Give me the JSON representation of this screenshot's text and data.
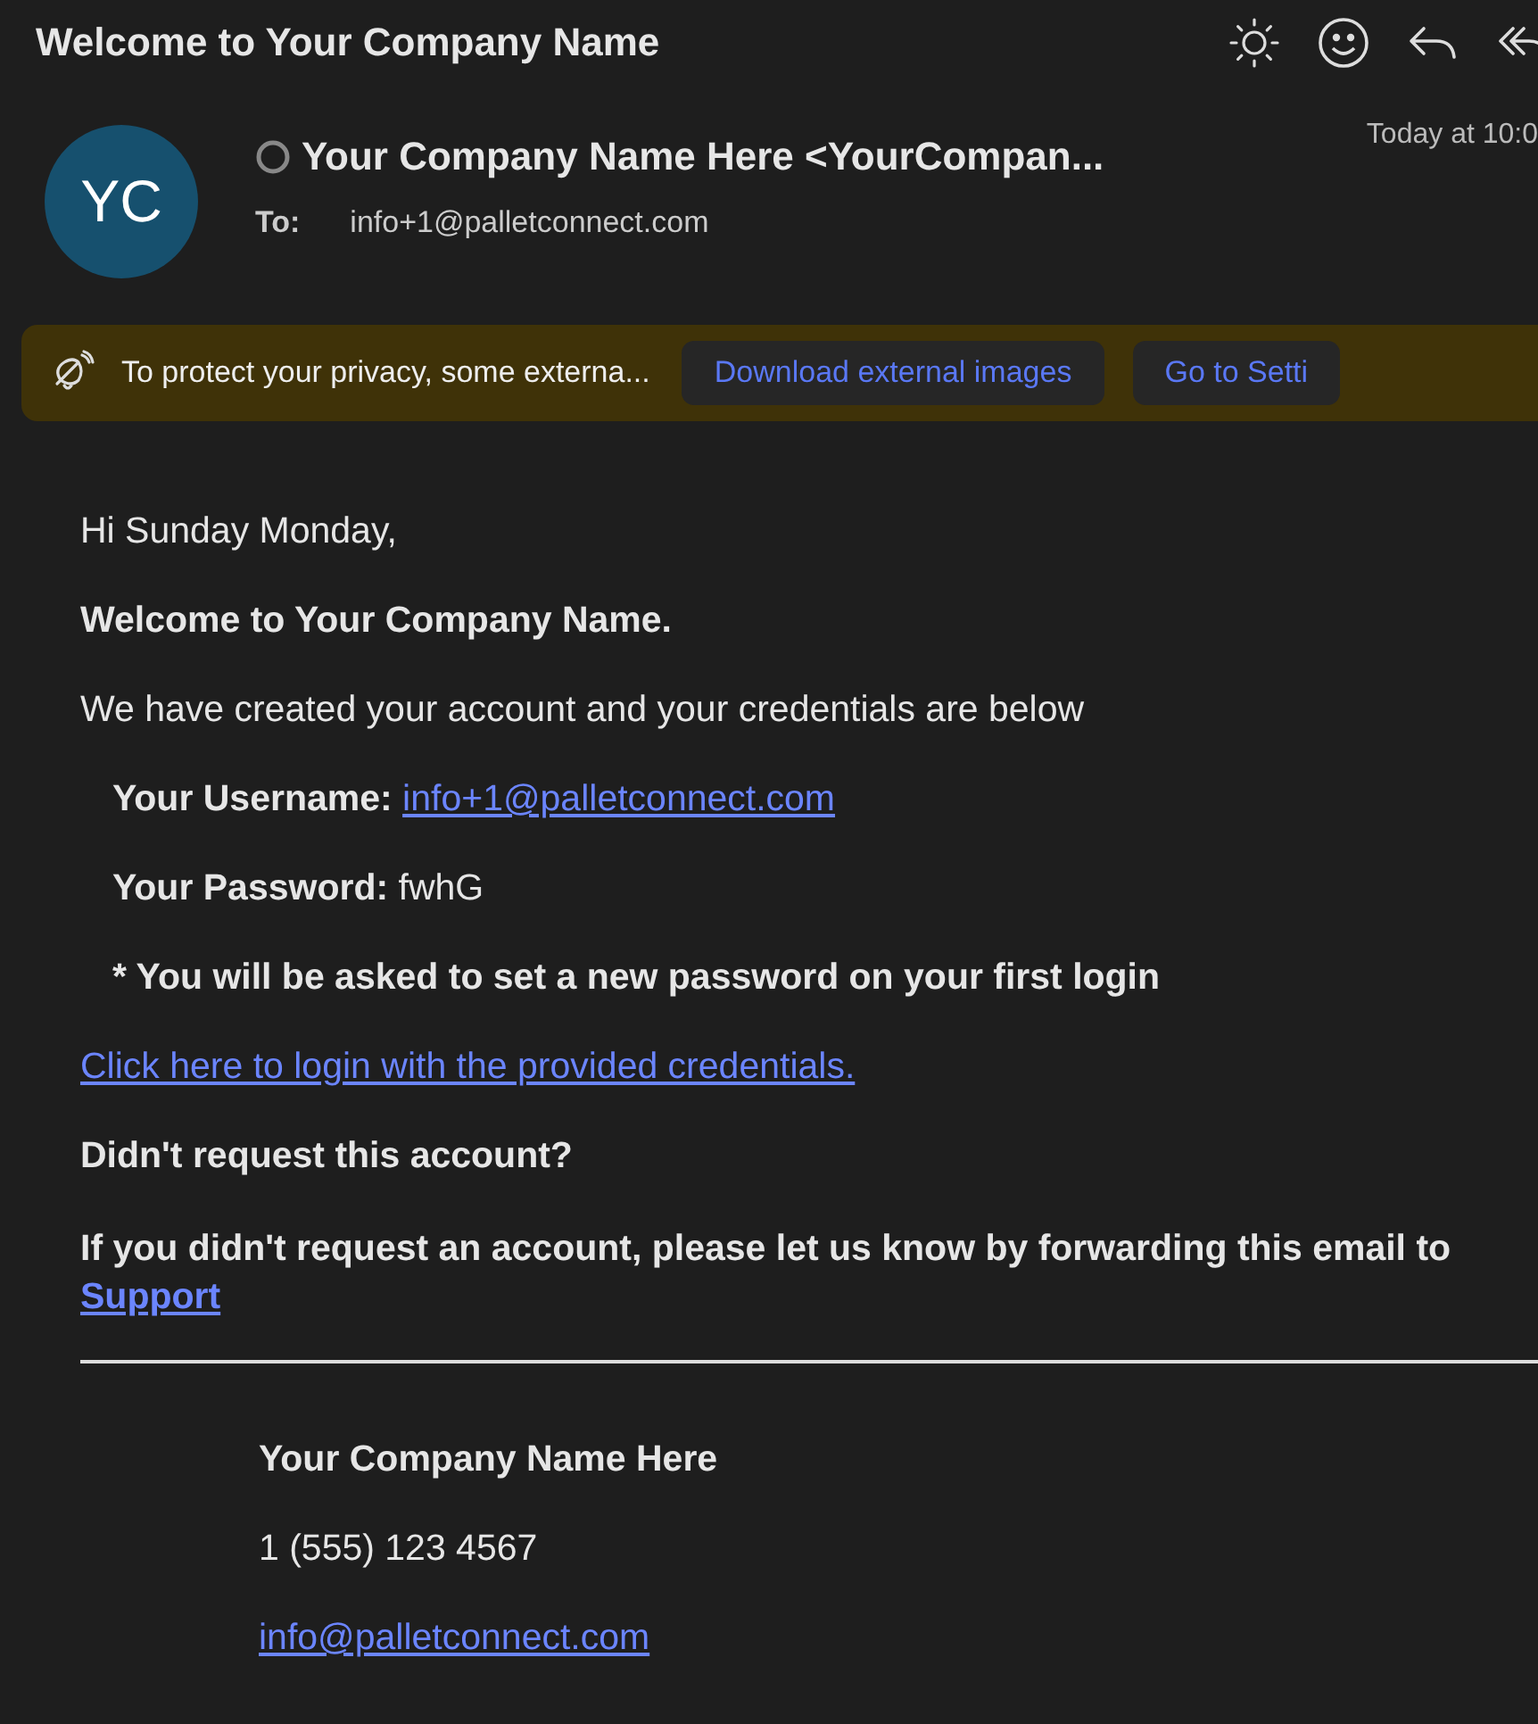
{
  "subject": "Welcome to Your Company Name",
  "sender": {
    "initials": "YC",
    "name": "Your Company Name Here <YourCompan...",
    "time": "Today at 10:0",
    "to_label": "To:",
    "to": "info+1@palletconnect.com"
  },
  "banner": {
    "text": "To protect your privacy, some externa...",
    "buttons": [
      "Download external images",
      "Go to Setti"
    ]
  },
  "body": [
    {
      "kind": "plain",
      "text": "Hi Sunday Monday,"
    },
    {
      "kind": "bold",
      "text": "Welcome to Your Company Name."
    },
    {
      "kind": "plain",
      "text": "We have created your account and your credentials are below"
    },
    {
      "kind": "field",
      "label": "Your Username:",
      "value": "info+1@palletconnect.com",
      "link": true
    },
    {
      "kind": "field",
      "label": "Your Password:",
      "value": "fwhG",
      "link": false
    },
    {
      "kind": "note",
      "text": "* You will be asked to set a new password on your first login"
    },
    {
      "kind": "link",
      "text": "Click here to login with the provided credentials."
    },
    {
      "kind": "bold",
      "text": "Didn't request this account?"
    },
    {
      "kind": "bold_link",
      "text": "If you didn't request an account, please let us know by forwarding this email to",
      "link": "Support"
    }
  ],
  "signature": {
    "company": "Your Company Name Here",
    "phone": "1 (555) 123 4567",
    "email": "info@palletconnect.com"
  }
}
